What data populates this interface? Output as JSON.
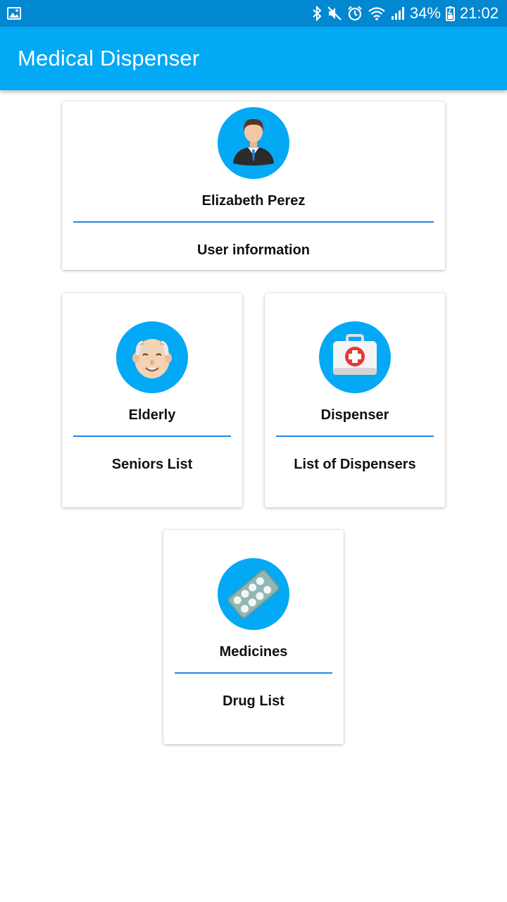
{
  "status_bar": {
    "battery_percent": "34%",
    "time": "21:02",
    "icons": [
      "image-notification-icon",
      "bluetooth-icon",
      "mute-icon",
      "alarm-icon",
      "wifi-icon",
      "signal-icon",
      "battery-icon"
    ]
  },
  "app_bar": {
    "title": "Medical Dispenser"
  },
  "cards": {
    "user": {
      "icon": "user-avatar-icon",
      "title": "Elizabeth Perez",
      "subtitle": "User information"
    },
    "elderly": {
      "icon": "elderly-man-icon",
      "title": "Elderly",
      "subtitle": "Seniors List"
    },
    "dispenser": {
      "icon": "first-aid-kit-icon",
      "title": "Dispenser",
      "subtitle": "List of Dispensers"
    },
    "medicines": {
      "icon": "pill-blister-icon",
      "title": "Medicines",
      "subtitle": "Drug List"
    }
  },
  "colors": {
    "status_bar": "#0288d1",
    "app_bar": "#03a9f4",
    "avatar_bg": "#03a9f4",
    "divider": "#1e88e5"
  }
}
